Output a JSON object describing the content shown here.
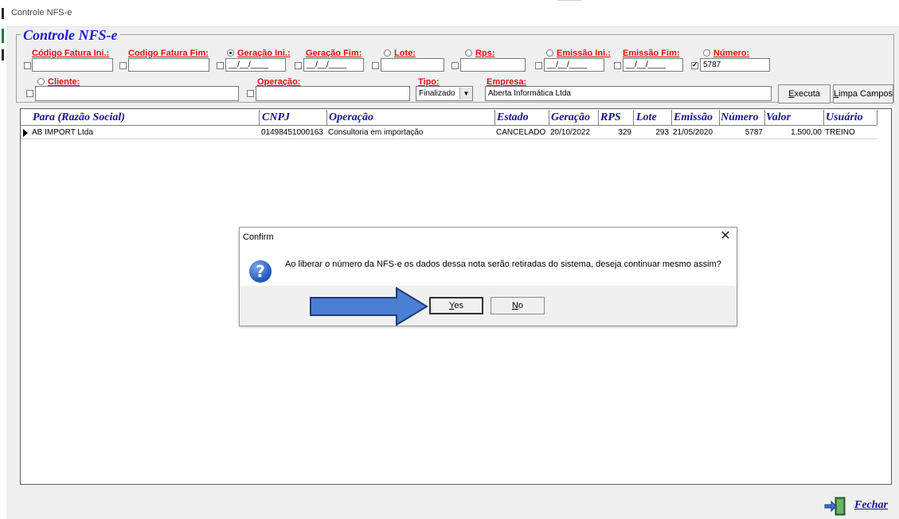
{
  "window": {
    "title": "Controle NFS-e"
  },
  "filters": {
    "group_caption": "Controle NFS-e",
    "codigo_fatura_ini": {
      "label": "Código Fatura Ini.:",
      "value": ""
    },
    "codigo_fatura_fim": {
      "label": "Codigo Fatura Fim:",
      "value": ""
    },
    "geracao_ini": {
      "label": "Geração Ini.:",
      "value": "__/__/____"
    },
    "geracao_fim": {
      "label": "Geração Fim:",
      "value": "__/__/____"
    },
    "lote": {
      "label": "Lote:",
      "value": ""
    },
    "rps": {
      "label": "Rps:",
      "value": ""
    },
    "emissao_ini": {
      "label": "Emissão Ini.:",
      "value": "__/__/____"
    },
    "emissao_fim": {
      "label": "Emissão Fim:",
      "value": "__/__/____"
    },
    "numero": {
      "label": "Número:",
      "value": "5787"
    },
    "cliente": {
      "label": "Cliente:",
      "value": ""
    },
    "operacao": {
      "label": "Operação:",
      "value": ""
    },
    "tipo": {
      "label": "Tipo:",
      "value": "Finalizado"
    },
    "empresa": {
      "label": "Empresa:",
      "value": "Aberta Informática Ltda"
    }
  },
  "buttons": {
    "executa_pre": "",
    "executa_key": "E",
    "executa_rest": "xecuta",
    "limpa_key": "L",
    "limpa_rest": "impa Campos",
    "fechar_key": "F",
    "fechar_rest": "echar"
  },
  "grid": {
    "headers": [
      "Para (Razão Social)",
      "CNPJ",
      "Operação",
      "Estado",
      "Geração",
      "RPS",
      "Lote",
      "Emissão",
      "Número",
      "Valor",
      "Usuário"
    ],
    "rows": [
      {
        "para": "AB IMPORT Ltda",
        "cnpj": "01498451000163",
        "operacao": "Consultoria em importação",
        "estado": "CANCELADO",
        "geracao": "20/10/2022",
        "rps": "329",
        "lote": "293",
        "emissao": "21/05/2020",
        "numero": "5787",
        "valor": "1.500,00",
        "usuario": "TREINO"
      }
    ]
  },
  "dialog": {
    "title": "Confirm",
    "message": "Ao liberar o número da NFS-e os dados dessa nota serão retiradas do sistema, deseja continuar mesmo assim?",
    "yes_key": "Y",
    "yes_rest": "es",
    "no_key": "N",
    "no_rest": "o",
    "close_symbol": "✕",
    "icon_glyph": "?"
  },
  "colors": {
    "label_red": "#e01010",
    "header_blue": "#14148c",
    "caption_blue": "#1b1bd1",
    "arrow_blue": "#4a7fd4"
  },
  "icons": [
    "question-icon",
    "row-indicator-icon",
    "exit-door-icon",
    "arrow-annotation",
    "close-icon"
  ]
}
